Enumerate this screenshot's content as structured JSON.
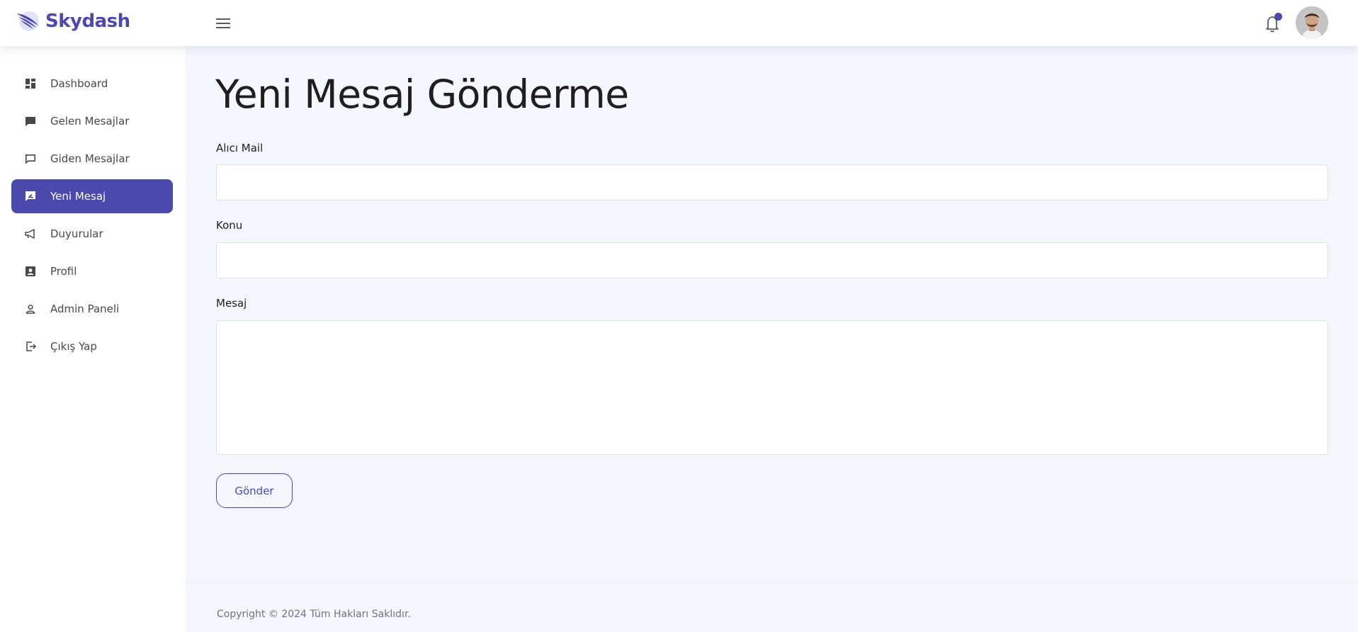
{
  "brand": {
    "name": "Skydash"
  },
  "header": {
    "menu_icon": "hamburger-icon",
    "notification_icon": "bell-icon",
    "accent_color": "#4b49ac"
  },
  "sidebar": {
    "items": [
      {
        "label": "Dashboard",
        "icon": "dashboard-icon",
        "active": false
      },
      {
        "label": "Gelen Mesajlar",
        "icon": "chat-filled-icon",
        "active": false
      },
      {
        "label": "Giden Mesajlar",
        "icon": "chat-outline-icon",
        "active": false
      },
      {
        "label": "Yeni Mesaj",
        "icon": "new-message-icon",
        "active": true
      },
      {
        "label": "Duyurular",
        "icon": "megaphone-icon",
        "active": false
      },
      {
        "label": "Profil",
        "icon": "profile-card-icon",
        "active": false
      },
      {
        "label": "Admin Paneli",
        "icon": "user-icon",
        "active": false
      },
      {
        "label": "Çıkış Yap",
        "icon": "logout-icon",
        "active": false
      }
    ]
  },
  "main": {
    "title": "Yeni Mesaj Gönderme",
    "form": {
      "recipient_label": "Alıcı Mail",
      "recipient_value": "",
      "subject_label": "Konu",
      "subject_value": "",
      "message_label": "Mesaj",
      "message_value": "",
      "submit_label": "Gönder"
    }
  },
  "footer": {
    "text": "Copyright © 2024 Tüm Hakları Saklıdır."
  }
}
